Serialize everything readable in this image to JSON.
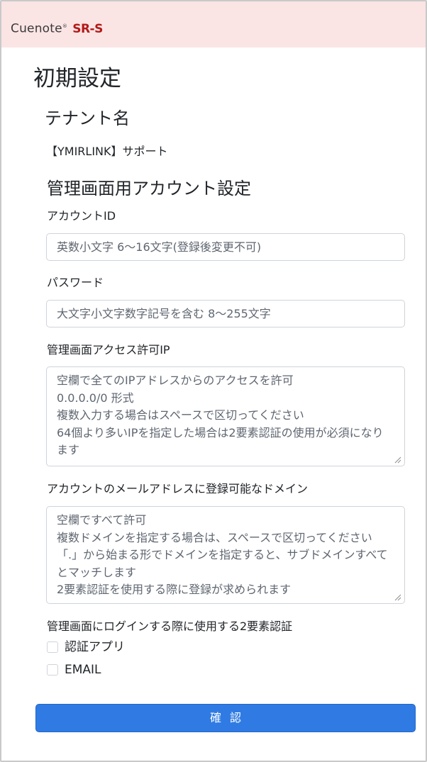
{
  "header": {
    "logo_main": "Cuenote",
    "logo_reg": "®",
    "logo_product": "SR-S"
  },
  "page": {
    "title": "初期設定"
  },
  "tenant": {
    "heading": "テナント名",
    "value": "【YMIRLINK】サポート"
  },
  "admin_account": {
    "heading": "管理画面用アカウント設定",
    "account_id": {
      "label": "アカウントID",
      "placeholder": "英数小文字 6～16文字(登録後変更不可)"
    },
    "password": {
      "label": "パスワード",
      "placeholder": "大文字小文字数字記号を含む 8～255文字"
    },
    "allowed_ip": {
      "label": "管理画面アクセス許可IP",
      "placeholder": "空欄で全てのIPアドレスからのアクセスを許可\n0.0.0.0/0 形式\n複数入力する場合はスペースで区切ってください\n64個より多いIPを指定した場合は2要素認証の使用が必須になります"
    },
    "mail_domain": {
      "label": "アカウントのメールアドレスに登録可能なドメイン",
      "placeholder": "空欄ですべて許可\n複数ドメインを指定する場合は、スペースで区切ってください\n「.」から始まる形でドメインを指定すると、サブドメインすべてとマッチします\n2要素認証を使用する際に登録が求められます"
    },
    "two_factor": {
      "label": "管理画面にログインする際に使用する2要素認証",
      "options": [
        {
          "label": "認証アプリ",
          "checked": false
        },
        {
          "label": "EMAIL",
          "checked": false
        }
      ]
    }
  },
  "actions": {
    "confirm_label": "確認"
  },
  "colors": {
    "header_bg": "#fbe4e4",
    "brand_red": "#b21a1a",
    "primary_button": "#2f7be3"
  }
}
